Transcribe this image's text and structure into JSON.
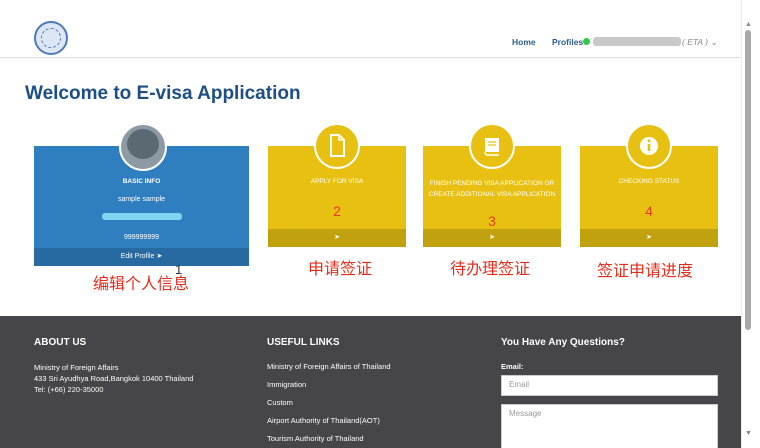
{
  "nav": {
    "home": "Home",
    "profiles": "Profiles",
    "user_suffix": "( ETA )",
    "dropdown_icon": "chevron-down-icon"
  },
  "heading": "Welcome to E-visa Application",
  "cards": {
    "basic_info": {
      "title": "BASIC INFO",
      "name": "sample sample",
      "phone": "999999999",
      "footer": "Edit Profile",
      "number": "1",
      "annotation": "编辑个人信息"
    },
    "apply": {
      "title": "APPLY FOR VISA",
      "number": "2",
      "annotation": "申请签证",
      "icon": "document-icon"
    },
    "pending": {
      "title": "FINISH PENDING VISA APPLICATION OR CREATE ADDITIONAL VISA APPLICATION",
      "number": "3",
      "annotation": "待办理签证",
      "icon": "book-icon"
    },
    "status": {
      "title": "CHECKING STATUS",
      "number": "4",
      "annotation": "签证申请进度",
      "icon": "info-icon"
    }
  },
  "footer": {
    "about_title": "ABOUT US",
    "about_lines": [
      "Ministry of Foreign Affairs",
      "433 Sri Ayudhya Road,Bangkok 10400 Thailand",
      "Tel: (+66) 220-35000"
    ],
    "links_title": "USEFUL LINKS",
    "links": [
      "Ministry of Foreign Affairs of Thailand",
      "Immigration",
      "Custom",
      "Airport Authority of Thailand(AOT)",
      "Tourism Authority of Thailand"
    ],
    "questions_title": "You Have Any Questions?",
    "email_label": "Email:",
    "email_placeholder": "Email",
    "message_placeholder": "Message"
  },
  "colors": {
    "primary_blue": "#2f7fc0",
    "heading_blue": "#1d4f86",
    "card_yellow": "#e8c012",
    "annotation_red": "#e32d1c",
    "footer_bg": "#45454a"
  }
}
